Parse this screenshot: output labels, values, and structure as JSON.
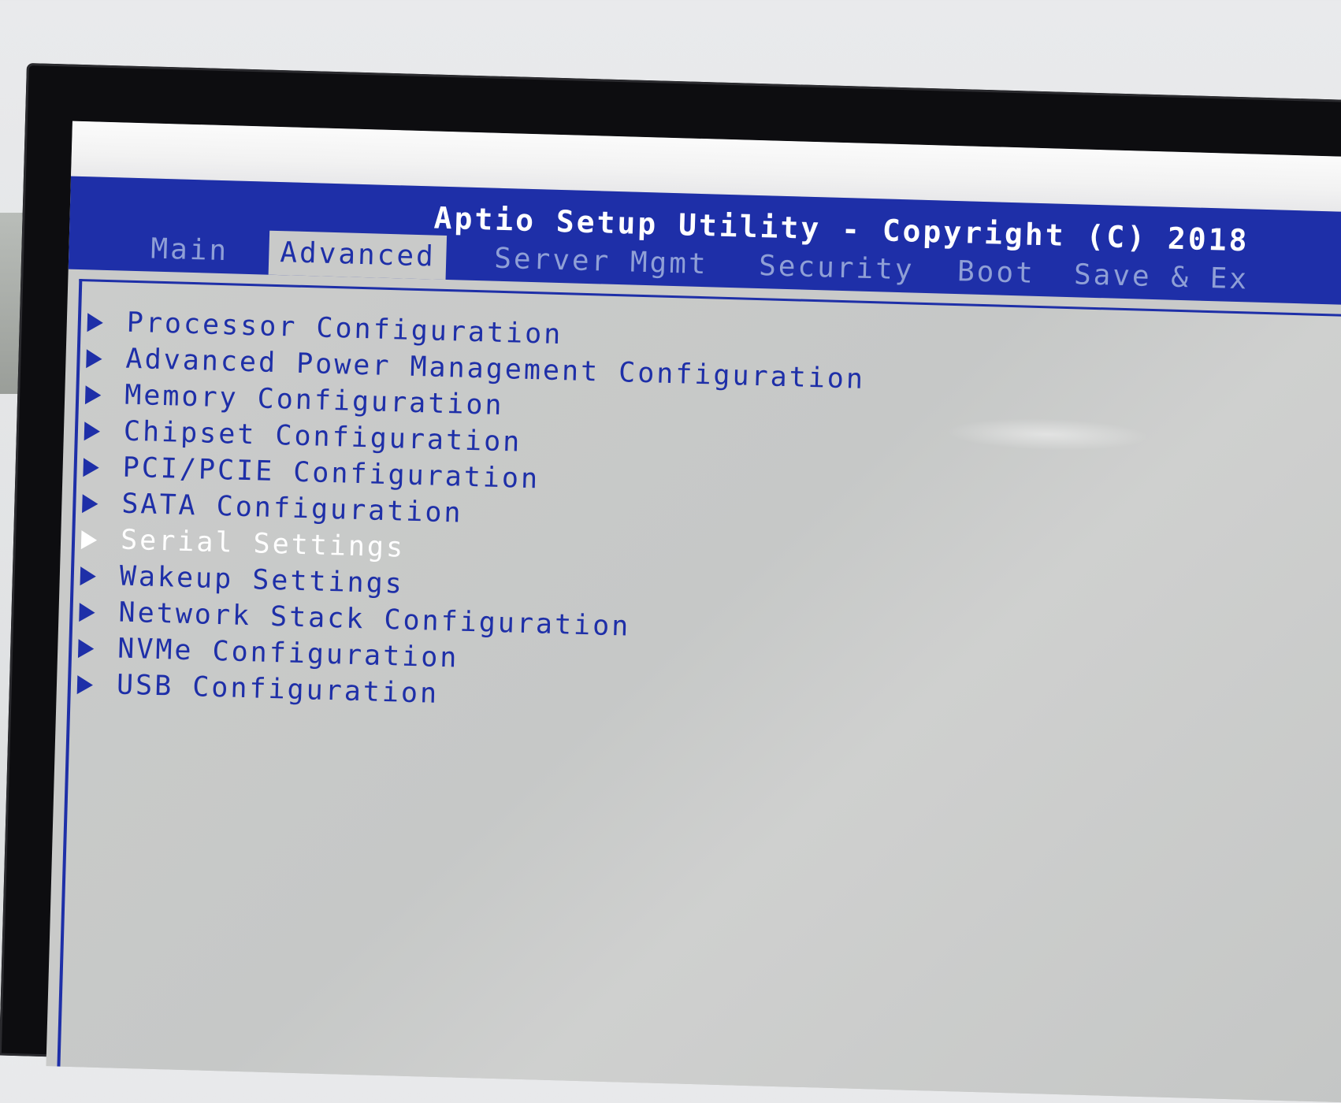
{
  "bios": {
    "title": "Aptio Setup Utility - Copyright (C) 2018",
    "tabs": [
      {
        "label": "Main",
        "active": false
      },
      {
        "label": "Advanced",
        "active": true
      },
      {
        "label": "Server Mgmt",
        "active": false
      },
      {
        "label": "Security",
        "active": false
      },
      {
        "label": "Boot",
        "active": false
      },
      {
        "label": "Save & Ex",
        "active": false
      }
    ],
    "menu": [
      {
        "label": "Processor Configuration",
        "selected": false
      },
      {
        "label": "Advanced Power Management Configuration",
        "selected": false
      },
      {
        "label": "Memory Configuration",
        "selected": false
      },
      {
        "label": "Chipset Configuration",
        "selected": false
      },
      {
        "label": "PCI/PCIE Configuration",
        "selected": false
      },
      {
        "label": "SATA Configuration",
        "selected": false
      },
      {
        "label": "Serial Settings",
        "selected": true
      },
      {
        "label": "Wakeup Settings",
        "selected": false
      },
      {
        "label": "Network Stack Configuration",
        "selected": false
      },
      {
        "label": "NVMe Configuration",
        "selected": false
      },
      {
        "label": "USB Configuration",
        "selected": false
      }
    ]
  },
  "colors": {
    "bios_blue": "#1e2fa8",
    "bios_gray": "#c9cac9",
    "inactive_tab": "#8f9fd6",
    "selected_text": "#ffffff"
  },
  "icons": {
    "submenu": "triangle-right-icon"
  }
}
